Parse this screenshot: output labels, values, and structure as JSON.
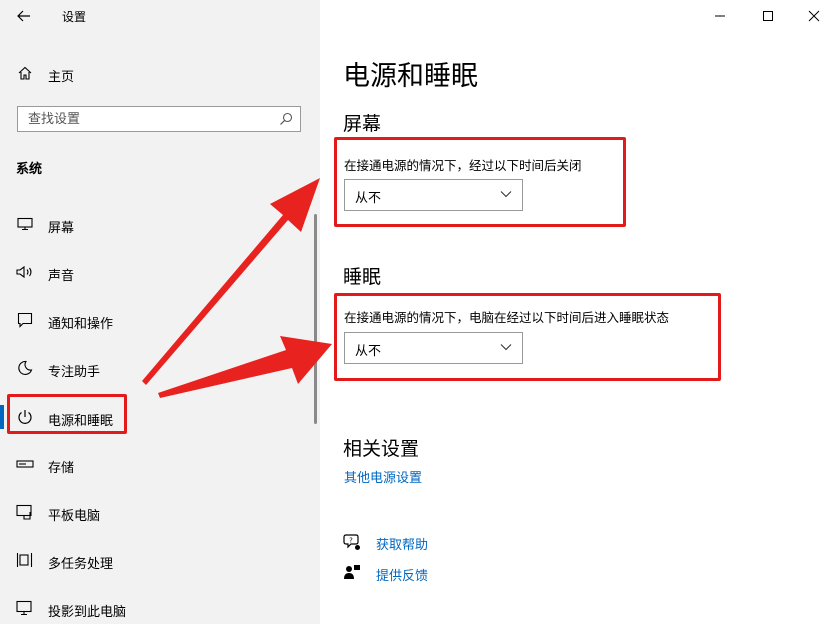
{
  "window": {
    "title": "设置"
  },
  "sidebar": {
    "home": "主页",
    "search": {
      "placeholder": "查找设置"
    },
    "section": "系统",
    "items": [
      {
        "label": "屏幕",
        "icon": "monitor-icon"
      },
      {
        "label": "声音",
        "icon": "speaker-icon"
      },
      {
        "label": "通知和操作",
        "icon": "notification-icon"
      },
      {
        "label": "专注助手",
        "icon": "moon-icon"
      },
      {
        "label": "电源和睡眠",
        "icon": "power-icon",
        "selected": true
      },
      {
        "label": "存储",
        "icon": "storage-icon"
      },
      {
        "label": "平板电脑",
        "icon": "tablet-icon"
      },
      {
        "label": "多任务处理",
        "icon": "multitask-icon"
      },
      {
        "label": "投影到此电脑",
        "icon": "projection-icon"
      }
    ]
  },
  "main": {
    "title": "电源和睡眠",
    "screen": {
      "heading": "屏幕",
      "label": "在接通电源的情况下，经过以下时间后关闭",
      "value": "从不"
    },
    "sleep": {
      "heading": "睡眠",
      "label": "在接通电源的情况下，电脑在经过以下时间后进入睡眠状态",
      "value": "从不"
    },
    "related": {
      "heading": "相关设置",
      "link": "其他电源设置"
    },
    "help": {
      "get_help": "获取帮助",
      "feedback": "提供反馈"
    }
  },
  "colors": {
    "accent": "#0067c0",
    "annotation": "#e21a1a",
    "sidebar_bg": "#f2f2f2"
  }
}
